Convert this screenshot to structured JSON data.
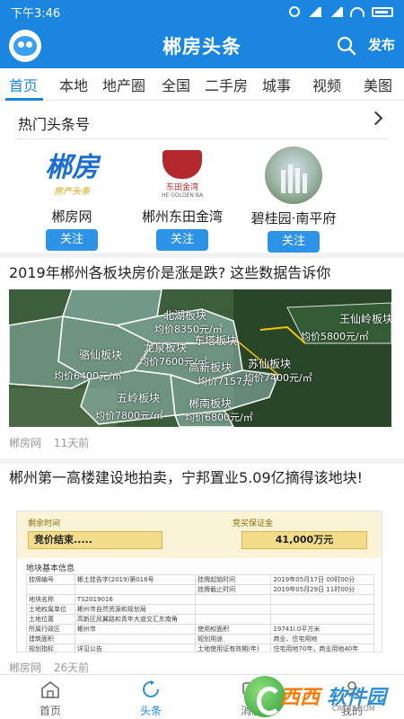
{
  "status": {
    "time": "下午3:46"
  },
  "appbar": {
    "title": "郴房头条",
    "publish": "发布"
  },
  "tabs": [
    {
      "label": "首页",
      "active": true
    },
    {
      "label": "本地"
    },
    {
      "label": "地产圈"
    },
    {
      "label": "全国"
    },
    {
      "label": "二手房"
    },
    {
      "label": "城事"
    },
    {
      "label": "视频"
    },
    {
      "label": "美图"
    }
  ],
  "hot": {
    "heading": "热门头条号",
    "accounts": [
      {
        "name": "郴房网",
        "logo_text": "郴房",
        "logo_sub": "房产头条",
        "follow": "关注"
      },
      {
        "name": "郴州东田金湾",
        "logo_text": "东田金湾",
        "logo_sub": "HE GOLDEN BA",
        "follow": "关注"
      },
      {
        "name": "碧桂园·南平府",
        "follow": "关注"
      }
    ]
  },
  "articles": [
    {
      "title": "2019年郴州各板块房价是涨是跌? 这些数据告诉你",
      "source": "郴房网",
      "time": "11天前",
      "map": {
        "labels": [
          "北湖板块",
          "骆仙板块",
          "龙泉板块",
          "东塔板块",
          "五岭板块",
          "苏仙板块",
          "高新板块",
          "郴南板块",
          "王仙岭板块"
        ],
        "prices": [
          "均价8350元/㎡",
          "均价7600元/㎡",
          "均价6400元/㎡",
          "均价7800元/㎡",
          "均价7157元",
          "均价7400元/㎡",
          "均价5800元/㎡",
          "均价6800元/㎡",
          "均价5800元/㎡"
        ]
      }
    },
    {
      "title": "郴州第一高楼建设地拍卖，宁邦置业5.09亿摘得该地块!",
      "source": "郴房网",
      "time": "26天前",
      "doc": {
        "left_head": "剩余时间",
        "right_head": "竞买保证金",
        "status": "竞价结束.....",
        "amount": "41,000万元",
        "info": "地块基本信息",
        "rows": [
          [
            "挂牌编号",
            "郴土挂告字(2019)第016号",
            "挂牌起始时间",
            "2019年05月17日 00时00分"
          ],
          [
            "",
            "",
            "挂牌截止时间",
            "2019年05月29日 11时00分"
          ],
          [
            "地块名称",
            "TS2019016",
            "",
            ""
          ],
          [
            "土地权属单位",
            "郴州市自然资源和规划局",
            "",
            ""
          ],
          [
            "土地位置",
            "高新区凤翼路和青年大道交汇东南角",
            "",
            ""
          ],
          [
            "所属行政区",
            "郴州市",
            "使用权面积",
            "19741l.0平方米"
          ],
          [
            "建筑面积",
            "",
            "规划用途",
            "商业、住宅用地"
          ],
          [
            "规划指标",
            "详见公告",
            "土地使用证有效期(年)",
            "住宅用地70年，商业用地40年"
          ]
        ]
      }
    }
  ],
  "bottomnav": [
    {
      "label": "首页",
      "icon": "home-icon"
    },
    {
      "label": "头条",
      "icon": "refresh-icon",
      "active": true
    },
    {
      "label": "消息",
      "icon": "message-icon"
    },
    {
      "label": "我的",
      "icon": "user-icon"
    }
  ],
  "watermark": {
    "text1": "西西",
    "text2": "软件园",
    "sub": "CR173.COM"
  },
  "colors": {
    "primary": "#1b86e0",
    "follow": "#2d93e6"
  }
}
